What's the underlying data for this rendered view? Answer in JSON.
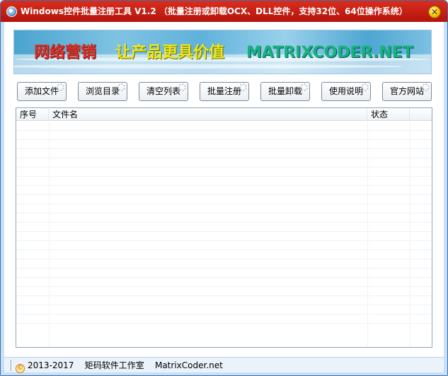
{
  "window": {
    "title": "Windows控件批量注册工具 V1.2 （批量注册或卸载OCX、DLL控件，支持32位、64位操作系统）",
    "close_glyph": "✕"
  },
  "banner": {
    "text1": "网络营销",
    "text2": "让产品更具价值",
    "text3": "MATRIXCODER.NET"
  },
  "toolbar": {
    "buttons": [
      {
        "label": "添加文件"
      },
      {
        "label": "浏览目录"
      },
      {
        "label": "清空列表"
      },
      {
        "label": "批量注册"
      },
      {
        "label": "批量卸载"
      },
      {
        "label": "使用说明"
      },
      {
        "label": "官方网站"
      }
    ]
  },
  "list": {
    "columns": [
      "序号",
      "文件名",
      "状态",
      ""
    ],
    "rows": []
  },
  "status": {
    "copyright_symbol": "©",
    "years": "2013-2017",
    "studio": "矩码软件工作室",
    "site": "MatrixCoder.net"
  },
  "colors": {
    "titlebar": "#c4200f",
    "accent": "#3a6fb0"
  }
}
